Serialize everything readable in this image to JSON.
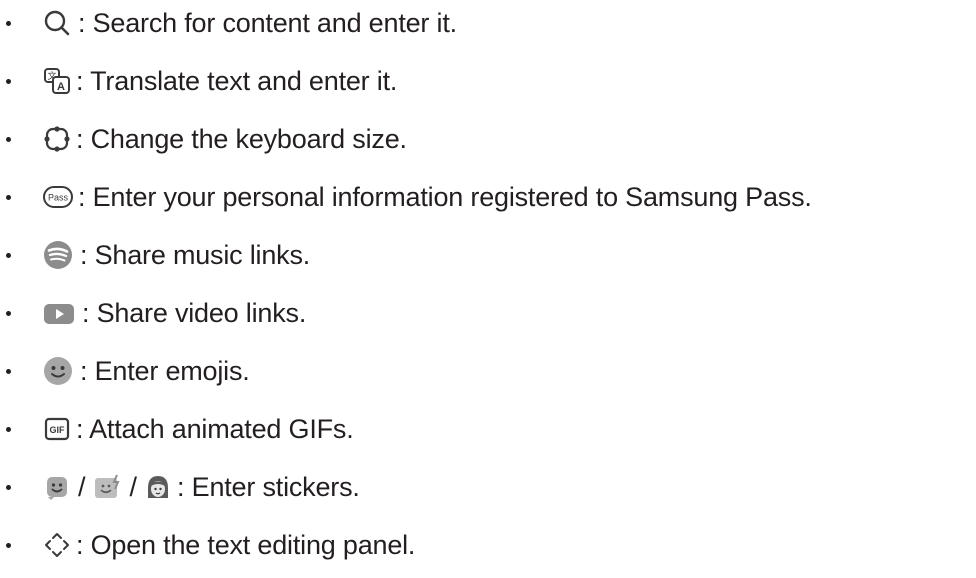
{
  "items": [
    {
      "icon": "search-icon",
      "text": ": Search for content and enter it."
    },
    {
      "icon": "translate-icon",
      "text": ": Translate text and enter it."
    },
    {
      "icon": "keyboard-size-icon",
      "text": ": Change the keyboard size."
    },
    {
      "icon": "samsung-pass-icon",
      "icon_text": "Pass",
      "text": ": Enter your personal information registered to Samsung Pass."
    },
    {
      "icon": "spotify-icon",
      "text": ": Share music links."
    },
    {
      "icon": "youtube-icon",
      "text": ": Share video links."
    },
    {
      "icon": "emoji-icon",
      "text": ": Enter emojis."
    },
    {
      "icon": "gif-icon",
      "icon_text": "GIF",
      "text": ": Attach animated GIFs."
    },
    {
      "icons": [
        "sticker-icon",
        "bitmoji-icon",
        "ar-emoji-icon"
      ],
      "separator": "/",
      "text": ": Enter stickers."
    },
    {
      "icon": "text-editing-icon",
      "text": ": Open the text editing panel."
    }
  ],
  "colors": {
    "text": "#231f20",
    "icon_gray": "#8c8c8c",
    "icon_dark": "#3a3a3a"
  }
}
